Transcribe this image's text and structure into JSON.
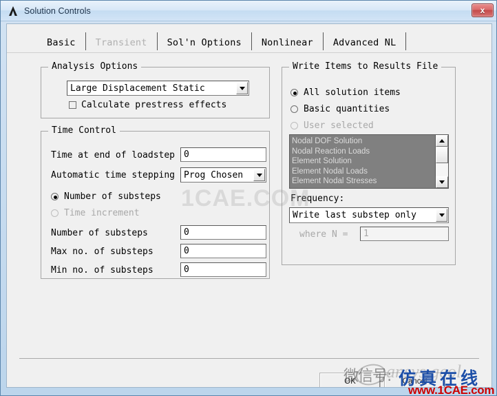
{
  "window": {
    "title": "Solution Controls",
    "app_icon": "ansys-lambda-icon",
    "close_label": "x"
  },
  "tabs": [
    {
      "label": "Basic",
      "state": "active"
    },
    {
      "label": "Transient",
      "state": "disabled"
    },
    {
      "label": "Sol'n Options",
      "state": "enabled"
    },
    {
      "label": "Nonlinear",
      "state": "enabled"
    },
    {
      "label": "Advanced NL",
      "state": "enabled"
    }
  ],
  "analysis_options": {
    "legend": "Analysis Options",
    "analysis_type_value": "Large Displacement Static",
    "prestress_label": "Calculate prestress effects",
    "prestress_checked": false
  },
  "time_control": {
    "legend": "Time Control",
    "time_end_label": "Time at end of loadstep",
    "time_end_value": "0",
    "auto_time_label": "Automatic time stepping",
    "auto_time_value": "Prog Chosen",
    "radio_substeps_label": "Number of substeps",
    "radio_timeinc_label": "Time increment",
    "selected_radio": "Number of substeps",
    "num_substeps_label": "Number of substeps",
    "num_substeps_value": "0",
    "max_substeps_label": "Max no. of substeps",
    "max_substeps_value": "0",
    "min_substeps_label": "Min no. of substeps",
    "min_substeps_value": "0"
  },
  "write_items": {
    "legend": "Write Items to Results File",
    "radios": [
      {
        "label": "All solution items",
        "selected": true
      },
      {
        "label": "Basic quantities",
        "selected": false
      },
      {
        "label": "User selected",
        "selected": false
      }
    ],
    "list_items": [
      "Nodal DOF Solution",
      "Nodal Reaction Loads",
      "Element Solution",
      "Element Nodal Loads",
      "Element Nodal Stresses"
    ],
    "frequency_label": "Frequency:",
    "frequency_value": "Write last substep only",
    "where_n_label": "where N =",
    "where_n_value": "1"
  },
  "buttons": {
    "ok": "OK",
    "cancel": "Cancel"
  },
  "watermarks": {
    "center": "1CAE.COM",
    "wechat": "微信号:",
    "ghost": "ansys.geol",
    "brand": "仿真在线",
    "url": "www.1CAE.com"
  },
  "colors": {
    "titlebar_accent": "#c4dcf2",
    "close_red": "#c34a4a",
    "dialog_face": "#f0f0f0",
    "list_disabled_bg": "#808080",
    "brand_blue": "#1d4fa8",
    "brand_red": "#cc0000"
  }
}
